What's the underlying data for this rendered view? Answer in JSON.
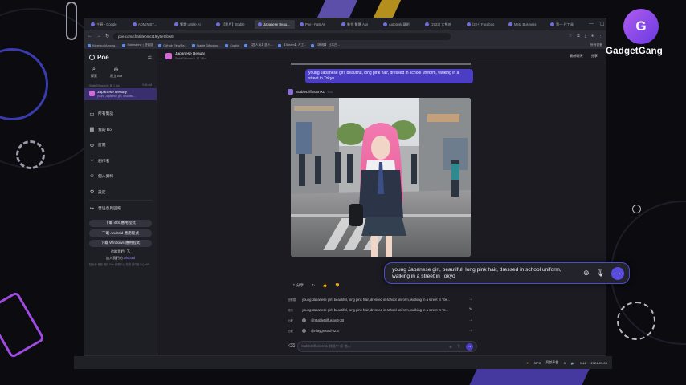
{
  "browser": {
    "tabs": [
      {
        "label": "主頁 - Google",
        "active": false
      },
      {
        "label": "ADMINIST...",
        "active": false
      },
      {
        "label": "繁體 untitle AI",
        "active": false
      },
      {
        "label": "【影片】Stable",
        "active": false
      },
      {
        "label": "Japanese Beau...",
        "active": true
      },
      {
        "label": "Poe - Fast AI",
        "active": false
      },
      {
        "label": "動作 繁體 Ass",
        "active": false
      },
      {
        "label": "Autotask 藝術",
        "active": false
      },
      {
        "label": "(2123) 大熊爸",
        "active": false
      },
      {
        "label": "(22+) Faceboo",
        "active": false
      },
      {
        "label": "Meta Business",
        "active": false
      },
      {
        "label": "第十 代工具",
        "active": false
      }
    ],
    "url": "poe.com/chat/3ebmcr19ly8ethbw8",
    "bookmarks": [
      "Kimetsu (Among...",
      "Submarine | 藝術圖",
      "GitHub Ring/Pa...",
      "Stable Diffusion...",
      "Copilot",
      "【超人氣】藝人...",
      "【Steam】人工...",
      "【轉換】日本百..."
    ],
    "bookmarks_right": "所有書籤"
  },
  "sidebar": {
    "brand": "Poe",
    "quick": [
      {
        "icon": "search-icon",
        "label": "探索"
      },
      {
        "icon": "create-bot-icon",
        "label": "建立 Bot"
      }
    ],
    "recent_header": "StableDiffusionXL 和 1 Bot",
    "recent_time": "9:44 AM",
    "active_chat": {
      "title": "Japanese Beauty",
      "subtitle": "young Japanese girl, beautiful..."
    },
    "items": [
      {
        "icon": "chats-icon",
        "label": "所有對話"
      },
      {
        "icon": "bots-icon",
        "label": "我的 Bot"
      },
      {
        "icon": "subscribe-icon",
        "label": "訂閱"
      },
      {
        "icon": "creator-icon",
        "label": "創作者"
      },
      {
        "icon": "profile-icon",
        "label": "個人資料"
      },
      {
        "icon": "settings-icon",
        "label": "設定"
      },
      {
        "icon": "feedback-icon",
        "label": "發送意見回饋"
      }
    ],
    "downloads": [
      "下載 iOS 應用程式",
      "下載 Android 應用程式",
      "下載 Windows 應用程式"
    ],
    "follow": "追蹤我們",
    "join": "加入我們的",
    "join_link": "Discord",
    "footer": "隱私權‧條款‧關於 Poe‧說明中心‧幫助‧創作者中心‧API"
  },
  "chat": {
    "bot_name": "Japanese Beauty",
    "bot_sub": "StableDiffusionXL 和 1 Bot",
    "header_actions": [
      "最新聊天",
      "分享"
    ],
    "user_prompt": "young Japanese girl, beautiful, long pink hair, dressed in school uniform, walking in a street in Tokyo",
    "reply_bot": "StableDiffusionXL",
    "reply_time": "9:44",
    "actions": [
      "分享",
      "↻",
      "👍",
      "👎"
    ],
    "suggestions": [
      {
        "label": "回覆類",
        "text": "young Japanese girl, beautiful, long pink hair, dressed in school uniform, walking in a street in Tok..."
      },
      {
        "label": "修改",
        "text": "young Japanese girl, beautiful, long pink hair, dressed in school uniform, walking in a street in To..."
      },
      {
        "label": "比較",
        "text": "@StableDiffusion3-2B"
      },
      {
        "label": "比較",
        "text": "@Playground-v2.5"
      }
    ],
    "input_placeholder": "StableDiffusionXL 對話中 @ 他人",
    "zoom_input_text": "young Japanese girl, beautiful, long pink hair, dressed in school uniform, walking in a street in Tokyo"
  },
  "taskbar": {
    "weather": "33°C",
    "weather_sub": "局部多雲",
    "time": "9:44",
    "date": "2024-07-05"
  },
  "overlay": {
    "brand": "GadgetGang",
    "brand_mark": "G"
  }
}
